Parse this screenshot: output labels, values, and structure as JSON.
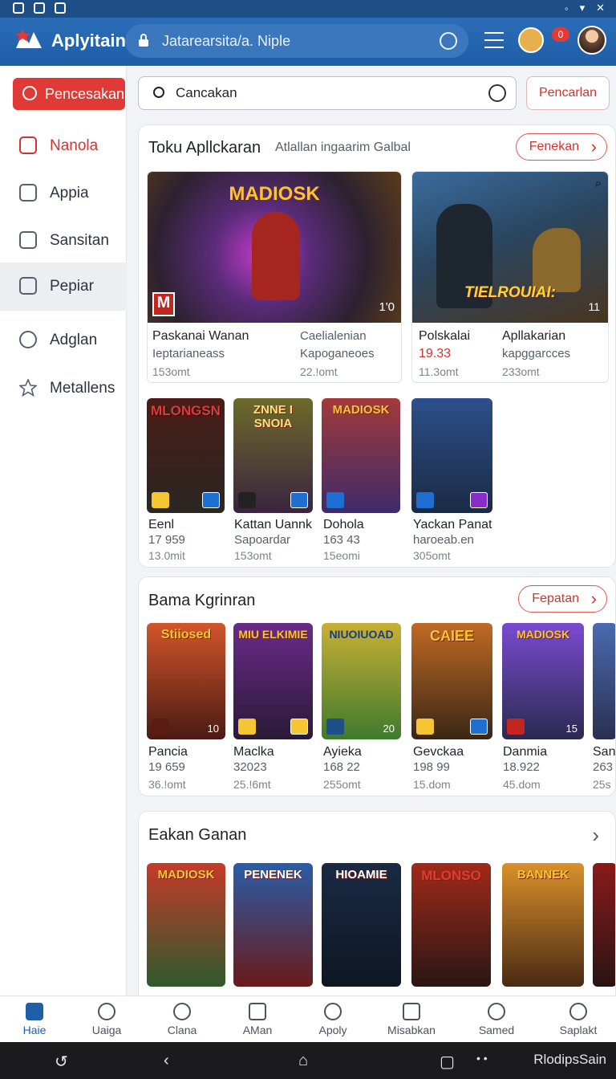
{
  "app": {
    "name": "Aplyitain",
    "url": "Jatarearsita/a. Niple",
    "notification_count": "0"
  },
  "colors": {
    "accent": "#df3a35",
    "topbar": "#1f5ea8"
  },
  "sidebar": {
    "primary_button": "Pencesakan",
    "items": [
      {
        "label": "Nanola",
        "icon": "home-icon"
      },
      {
        "label": "Appia",
        "icon": "house-icon"
      },
      {
        "label": "Sansitan",
        "icon": "edit-icon"
      },
      {
        "label": "Pepiar",
        "icon": "clipboard-icon"
      },
      {
        "label": "Adglan",
        "icon": "search-icon"
      },
      {
        "label": "Metallens",
        "icon": "star-icon"
      }
    ]
  },
  "search": {
    "value": "Cancakan",
    "button": "Pencarlan"
  },
  "section1": {
    "title": "Toku Apllckaran",
    "subtitle": "Atlallan ingaarim Galbal",
    "pill": "Fenekan",
    "featured": [
      {
        "cover": "MADIOSK",
        "badge": "1'0",
        "cols": [
          [
            "Paskanai Wanan",
            "Ieptarianeass",
            "153omt"
          ],
          [
            "Caelialenian",
            "Kapoganeoes",
            "22.!omt"
          ]
        ]
      },
      {
        "cover": "TIELROUIAI:",
        "badge": "11",
        "cols": [
          [
            "Polskalai",
            "19.33",
            "11.3omt"
          ],
          [
            "Apllakarian",
            "kapggarcces",
            "233omt"
          ]
        ]
      }
    ],
    "tiles": [
      {
        "cover": "MLONGSN",
        "name": "Eenl",
        "num": "17 959",
        "size": "13.0mit"
      },
      {
        "cover": "ZNNE I SNOIA",
        "name": "Kattan Uannk",
        "num": "Sapoardar",
        "size": "153omt"
      },
      {
        "cover": "MADIOSK",
        "name": "Dohola",
        "num": "163 43",
        "size": "15eomi"
      },
      {
        "cover": "",
        "name": "Yackan Panat",
        "num": "haroeab.en",
        "size": "305omt"
      }
    ]
  },
  "section2": {
    "title": "Bama Kgrinran",
    "pill": "Fepatan",
    "tiles": [
      {
        "cover": "Stiiosed",
        "name": "Pancia",
        "num": "19 659",
        "size": "36.!omt",
        "badge": "10"
      },
      {
        "cover": "MIU ELKIMIE",
        "name": "Maclka",
        "num": "32023",
        "size": "25.!6mt",
        "badge": ""
      },
      {
        "cover": "NIUOIUOAD",
        "name": "Ayieka",
        "num": "168 22",
        "size": "255omt",
        "badge": "20"
      },
      {
        "cover": "CAIEE",
        "name": "Gevckaa",
        "num": "198 99",
        "size": "15.dom",
        "badge": ""
      },
      {
        "cover": "MADIOSK",
        "name": "Danmia",
        "num": "18.922",
        "size": "45.dom",
        "badge": "15"
      },
      {
        "cover": "",
        "name": "San",
        "num": "263",
        "size": "25s",
        "badge": ""
      }
    ]
  },
  "section3": {
    "title": "Eakan Ganan",
    "tiles": [
      {
        "cover": "MADIOSK"
      },
      {
        "cover": "PENENEK"
      },
      {
        "cover": "HIOAMIE"
      },
      {
        "cover": "MLONSO"
      },
      {
        "cover": "BANNEK"
      },
      {
        "cover": ""
      }
    ]
  },
  "bottom_nav": [
    {
      "label": "Haie",
      "icon": "home-icon"
    },
    {
      "label": "Uaiga",
      "icon": "grid-icon"
    },
    {
      "label": "Clana",
      "icon": "house-icon"
    },
    {
      "label": "AMan",
      "icon": "card-icon"
    },
    {
      "label": "Apoly",
      "icon": "search-icon"
    },
    {
      "label": "Misabkan",
      "icon": "notes-icon"
    },
    {
      "label": "Samed",
      "icon": "circle-icon"
    },
    {
      "label": "Saplakt",
      "icon": "search-icon"
    }
  ],
  "system_bar": {
    "label": "RlodipsSain"
  }
}
